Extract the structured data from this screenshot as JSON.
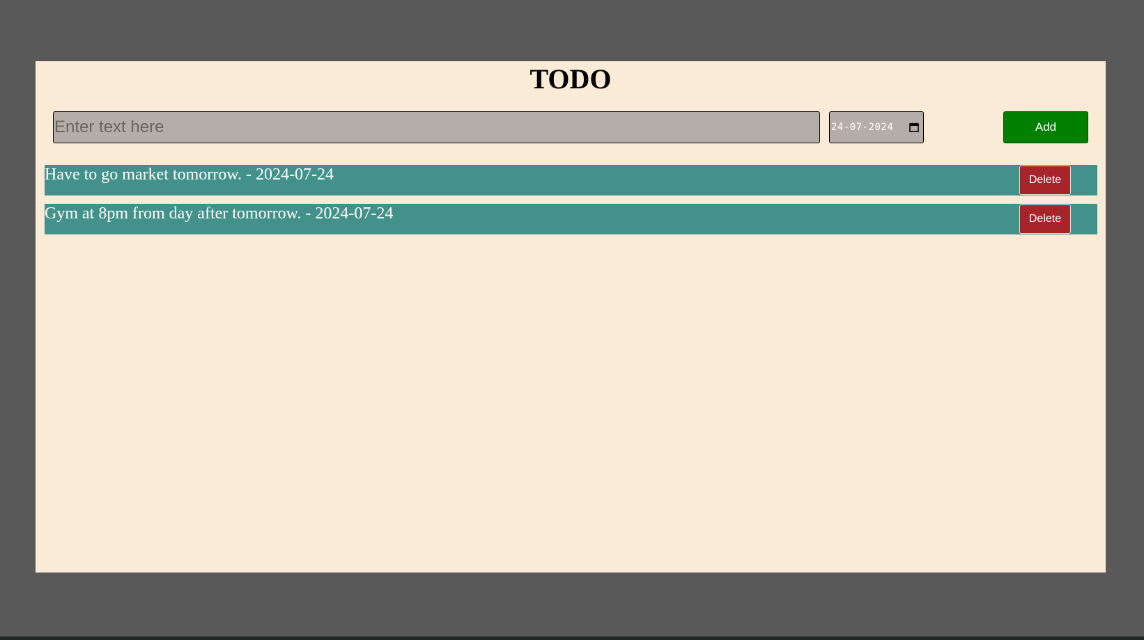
{
  "app": {
    "title": "TODO"
  },
  "form": {
    "text_placeholder": "Enter text here",
    "text_value": "",
    "date_value": "24-07-2024",
    "add_label": "Add"
  },
  "todos": [
    {
      "text": "Have to go market tomorrow. - 2024-07-24",
      "delete_label": "Delete"
    },
    {
      "text": "Gym at 8pm from day after tomorrow. - 2024-07-24",
      "delete_label": "Delete"
    }
  ],
  "colors": {
    "page_background": "#595959",
    "app_background": "#faebd7",
    "input_background": "#b5ada8",
    "todo_background": "#42918b",
    "add_button": "#008000",
    "delete_button": "#a7242a"
  },
  "icons": {
    "date_picker": "calendar-icon"
  }
}
